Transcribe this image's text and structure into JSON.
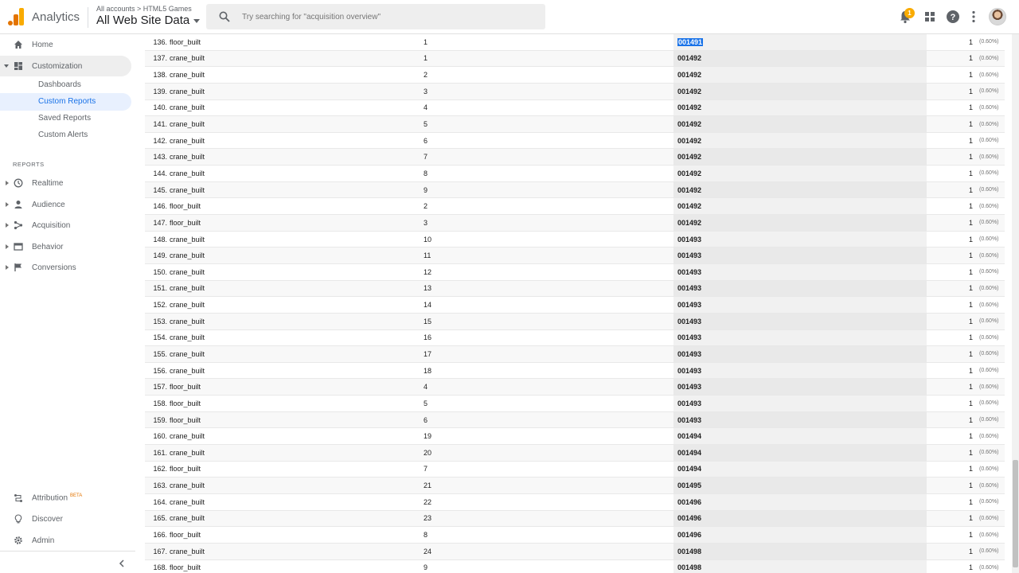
{
  "header": {
    "app_title": "Analytics",
    "breadcrumb": "All accounts > HTML5 Games",
    "view_name": "All Web Site Data",
    "search_placeholder": "Try searching for \"acquisition overview\"",
    "notification_count": "1",
    "colors": {
      "logo_orange": "#f9ab00",
      "logo_dark": "#e37400",
      "badge": "#f9ab00"
    }
  },
  "sidebar": {
    "home": "Home",
    "customization": "Customization",
    "customization_items": [
      "Dashboards",
      "Custom Reports",
      "Saved Reports",
      "Custom Alerts"
    ],
    "reports_section": "REPORTS",
    "reports": [
      "Realtime",
      "Audience",
      "Acquisition",
      "Behavior",
      "Conversions"
    ],
    "attribution": "Attribution",
    "attribution_badge": "BETA",
    "discover": "Discover",
    "admin": "Admin",
    "icons": {
      "home": "home-icon",
      "customization": "dashboard-grid-icon",
      "realtime": "clock-icon",
      "audience": "person-icon",
      "acquisition": "fork-icon",
      "behavior": "window-icon",
      "conversions": "flag-icon",
      "attribution": "route-icon",
      "discover": "bulb-icon",
      "admin": "gear-icon"
    }
  },
  "table": {
    "rows": [
      {
        "idx": "136.",
        "name": "floor_built",
        "num": "1",
        "code": "001491",
        "val": "1",
        "pct": "(0.60%)"
      },
      {
        "idx": "137.",
        "name": "crane_built",
        "num": "1",
        "code": "001492",
        "val": "1",
        "pct": "(0.60%)"
      },
      {
        "idx": "138.",
        "name": "crane_built",
        "num": "2",
        "code": "001492",
        "val": "1",
        "pct": "(0.60%)"
      },
      {
        "idx": "139.",
        "name": "crane_built",
        "num": "3",
        "code": "001492",
        "val": "1",
        "pct": "(0.60%)"
      },
      {
        "idx": "140.",
        "name": "crane_built",
        "num": "4",
        "code": "001492",
        "val": "1",
        "pct": "(0.60%)"
      },
      {
        "idx": "141.",
        "name": "crane_built",
        "num": "5",
        "code": "001492",
        "val": "1",
        "pct": "(0.60%)"
      },
      {
        "idx": "142.",
        "name": "crane_built",
        "num": "6",
        "code": "001492",
        "val": "1",
        "pct": "(0.60%)"
      },
      {
        "idx": "143.",
        "name": "crane_built",
        "num": "7",
        "code": "001492",
        "val": "1",
        "pct": "(0.60%)"
      },
      {
        "idx": "144.",
        "name": "crane_built",
        "num": "8",
        "code": "001492",
        "val": "1",
        "pct": "(0.60%)"
      },
      {
        "idx": "145.",
        "name": "crane_built",
        "num": "9",
        "code": "001492",
        "val": "1",
        "pct": "(0.60%)"
      },
      {
        "idx": "146.",
        "name": "floor_built",
        "num": "2",
        "code": "001492",
        "val": "1",
        "pct": "(0.60%)"
      },
      {
        "idx": "147.",
        "name": "floor_built",
        "num": "3",
        "code": "001492",
        "val": "1",
        "pct": "(0.60%)"
      },
      {
        "idx": "148.",
        "name": "crane_built",
        "num": "10",
        "code": "001493",
        "val": "1",
        "pct": "(0.60%)"
      },
      {
        "idx": "149.",
        "name": "crane_built",
        "num": "11",
        "code": "001493",
        "val": "1",
        "pct": "(0.60%)"
      },
      {
        "idx": "150.",
        "name": "crane_built",
        "num": "12",
        "code": "001493",
        "val": "1",
        "pct": "(0.60%)"
      },
      {
        "idx": "151.",
        "name": "crane_built",
        "num": "13",
        "code": "001493",
        "val": "1",
        "pct": "(0.60%)"
      },
      {
        "idx": "152.",
        "name": "crane_built",
        "num": "14",
        "code": "001493",
        "val": "1",
        "pct": "(0.60%)"
      },
      {
        "idx": "153.",
        "name": "crane_built",
        "num": "15",
        "code": "001493",
        "val": "1",
        "pct": "(0.60%)"
      },
      {
        "idx": "154.",
        "name": "crane_built",
        "num": "16",
        "code": "001493",
        "val": "1",
        "pct": "(0.60%)"
      },
      {
        "idx": "155.",
        "name": "crane_built",
        "num": "17",
        "code": "001493",
        "val": "1",
        "pct": "(0.60%)"
      },
      {
        "idx": "156.",
        "name": "crane_built",
        "num": "18",
        "code": "001493",
        "val": "1",
        "pct": "(0.60%)"
      },
      {
        "idx": "157.",
        "name": "floor_built",
        "num": "4",
        "code": "001493",
        "val": "1",
        "pct": "(0.60%)"
      },
      {
        "idx": "158.",
        "name": "floor_built",
        "num": "5",
        "code": "001493",
        "val": "1",
        "pct": "(0.60%)"
      },
      {
        "idx": "159.",
        "name": "floor_built",
        "num": "6",
        "code": "001493",
        "val": "1",
        "pct": "(0.60%)"
      },
      {
        "idx": "160.",
        "name": "crane_built",
        "num": "19",
        "code": "001494",
        "val": "1",
        "pct": "(0.60%)"
      },
      {
        "idx": "161.",
        "name": "crane_built",
        "num": "20",
        "code": "001494",
        "val": "1",
        "pct": "(0.60%)"
      },
      {
        "idx": "162.",
        "name": "floor_built",
        "num": "7",
        "code": "001494",
        "val": "1",
        "pct": "(0.60%)"
      },
      {
        "idx": "163.",
        "name": "crane_built",
        "num": "21",
        "code": "001495",
        "val": "1",
        "pct": "(0.60%)"
      },
      {
        "idx": "164.",
        "name": "crane_built",
        "num": "22",
        "code": "001496",
        "val": "1",
        "pct": "(0.60%)"
      },
      {
        "idx": "165.",
        "name": "crane_built",
        "num": "23",
        "code": "001496",
        "val": "1",
        "pct": "(0.60%)"
      },
      {
        "idx": "166.",
        "name": "floor_built",
        "num": "8",
        "code": "001496",
        "val": "1",
        "pct": "(0.60%)"
      },
      {
        "idx": "167.",
        "name": "crane_built",
        "num": "24",
        "code": "001498",
        "val": "1",
        "pct": "(0.60%)"
      },
      {
        "idx": "168.",
        "name": "floor_built",
        "num": "9",
        "code": "001498",
        "val": "1",
        "pct": "(0.60%)"
      }
    ]
  }
}
